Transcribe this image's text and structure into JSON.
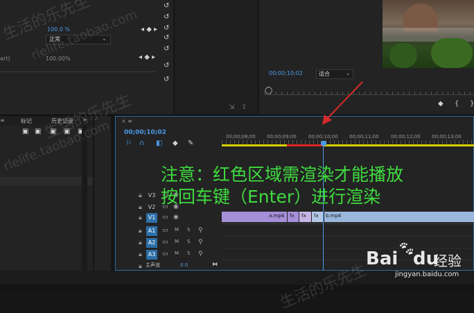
{
  "effect_controls": {
    "value_opacity": "100.0 %",
    "blend_mode": "正常",
    "value_speed": "100.00%",
    "truncated_label": "art)"
  },
  "program_monitor": {
    "timecode": "00;00;10;02",
    "fit_option": "适合"
  },
  "project_panel": {
    "tab_markers": "标记",
    "tab_history": "历史记录",
    "more": "»"
  },
  "timeline": {
    "timecode": "00;00;10;02",
    "ruler_labels": [
      "00;00;08;00",
      "00;00;09;00",
      "00;00;10;00",
      "00;00;11;00",
      "00;00;12;00",
      "00;00;13;00"
    ],
    "tracks": [
      {
        "name": "V3",
        "active": false
      },
      {
        "name": "V2",
        "active": false
      },
      {
        "name": "V1",
        "active": true
      },
      {
        "name": "A1",
        "active": true
      },
      {
        "name": "A2",
        "active": true
      },
      {
        "name": "A3",
        "active": true
      }
    ],
    "audio_m": "M",
    "audio_s": "S",
    "master_label": "主声道",
    "master_value": "0.0",
    "clips": {
      "clip_a": "a.mp4",
      "fx1": "fx",
      "fx2": "fx",
      "fx3": "fx",
      "clip_b": "b.mp4"
    }
  },
  "annotation": {
    "line1": "注意：红色区域需渲染才能播放",
    "line2": "按回车键（Enter）进行渲染"
  },
  "watermarks": {
    "wm1": "生活的乐先生",
    "wm2": "rlelife.taobao.com",
    "wm3": "生活的乐先生",
    "wm4": "rlelife.taobao.com",
    "wm5": "生活的乐先生"
  },
  "baidu": {
    "logo_text": "Bai",
    "logo_du": "du",
    "experience": "经验",
    "url": "jingyan.baidu.com"
  },
  "colors": {
    "accent_blue": "#4b9ae8",
    "annotation_green": "#3fdc3f",
    "video_clip": "#a58fd9",
    "video_clip_b": "#9ab7dc",
    "render_red": "#d22",
    "render_yellow": "#d8d000"
  }
}
